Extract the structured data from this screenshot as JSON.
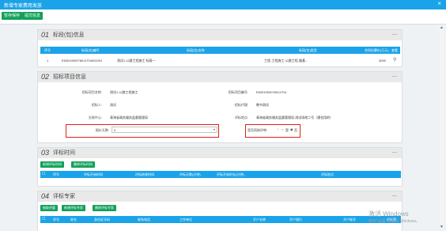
{
  "window": {
    "title": "新增专家费用发放",
    "close": "×"
  },
  "toolbar": {
    "save_label": "暂存保存",
    "submit_label": "提交信息"
  },
  "sections": {
    "s1": {
      "num": "01",
      "title": "标段(包)信息",
      "collapse": "—"
    },
    "s2": {
      "num": "02",
      "title": "招标项目信息",
      "collapse": "—"
    },
    "s3": {
      "num": "03",
      "title": "评标时间",
      "collapse": "—"
    },
    "s4": {
      "num": "04",
      "title": "评标专家",
      "collapse": "—"
    }
  },
  "bid_table": {
    "headers": [
      "序号",
      "标段(包)编号",
      "标段(包)名称",
      "标段(包)类型",
      "合同估算价(万元)",
      "查看"
    ],
    "rows": [
      {
        "index": "1",
        "code": "E6301000076011704001001",
        "name": "测试1-公路工程施工 标段一",
        "type": "工程-工程施工-公路工程-路基...",
        "amount": "3000",
        "view_icon": "search-icon"
      }
    ]
  },
  "project": {
    "name_label": "招标项目名称:",
    "name_value": "测试1-公路工程施工",
    "code_label": "招标项目编号:",
    "code_value": "E6301000076011704",
    "tenderer_label": "招标人:",
    "tenderer_value": "测试",
    "agency_label": "招标代理:",
    "agency_value": "教书测试",
    "center_label": "交易中心:",
    "center_value": "青海省政务服务监督管理局",
    "place_label": "评标地点:",
    "place_value": "青海省政务服务监督管理局 测试场地二号（通也用的）",
    "days_label": "报价天数:",
    "days_value": "0",
    "reeval_label": "是否再按评审:",
    "reeval_required": "*",
    "reeval_yes": "是",
    "reeval_no": "否"
  },
  "eval_time": {
    "add_label": "新增评标时间",
    "delete_label": "删除评标时间",
    "headers": [
      "序号",
      "评标开始时间",
      "评标结束时间",
      "评标天数(分钟)",
      "评标开始时长(分钟)",
      "评标地点"
    ]
  },
  "experts": {
    "draw_label": "抽取评委",
    "add_label": "新增评标专家",
    "delete_label": "删除评标专家",
    "headers": [
      "序号",
      "姓名",
      "身份证号码",
      "联系电话",
      "工作单位",
      "开户名称",
      "开户银行",
      "开户账号",
      "评标费"
    ]
  },
  "watermark": {
    "line1": "激活 Windows",
    "line2": "转到“设置”以激活 Windows。"
  }
}
